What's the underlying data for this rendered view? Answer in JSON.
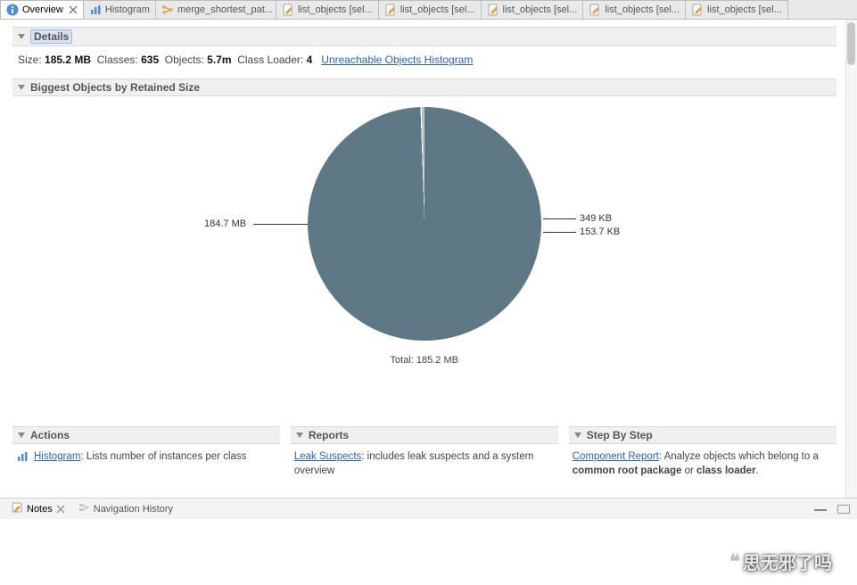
{
  "tabs": [
    {
      "label": "Overview",
      "icon": "info-icon",
      "active": true,
      "closable": true
    },
    {
      "label": "Histogram",
      "icon": "histogram-icon",
      "active": false,
      "closable": false
    },
    {
      "label": "merge_shortest_pat...",
      "icon": "merge-icon",
      "active": false,
      "closable": false
    },
    {
      "label": "list_objects [sel...",
      "icon": "doc-pencil-icon",
      "active": false,
      "closable": false
    },
    {
      "label": "list_objects [sel...",
      "icon": "doc-pencil-icon",
      "active": false,
      "closable": false
    },
    {
      "label": "list_objects [sel...",
      "icon": "doc-pencil-icon",
      "active": false,
      "closable": false
    },
    {
      "label": "list_objects [sel...",
      "icon": "doc-pencil-icon",
      "active": false,
      "closable": false
    },
    {
      "label": "list_objects [sel...",
      "icon": "doc-pencil-icon",
      "active": false,
      "closable": false
    }
  ],
  "sections": {
    "details_title": "Details",
    "biggest": "Biggest Objects by Retained Size",
    "actions": "Actions",
    "reports": "Reports",
    "step": "Step By Step"
  },
  "details": {
    "size_label": "Size:",
    "size_value": "185.2 MB",
    "classes_label": "Classes:",
    "classes_value": "635",
    "objects_label": "Objects:",
    "objects_value": "5.7m",
    "classloader_label": "Class Loader:",
    "classloader_value": "4",
    "unreachable_link": "Unreachable Objects Histogram"
  },
  "chart_data": {
    "type": "pie",
    "title": "",
    "total_label": "Total: 185.2 MB",
    "slices": [
      {
        "label": "184.7 MB",
        "value": 184.7,
        "unit": "MB",
        "color": "#5e7886"
      },
      {
        "label": "349 KB",
        "value": 0.341,
        "unit": "MB",
        "color": "#a8b9c2"
      },
      {
        "label": "153.7 KB",
        "value": 0.15,
        "unit": "MB",
        "color": "#c0ccd2"
      }
    ]
  },
  "actions": {
    "histogram_link": "Histogram",
    "histogram_desc": ": Lists number of instances per class"
  },
  "reports": {
    "leak_link": "Leak Suspects",
    "leak_desc": ": includes leak suspects and a system overview"
  },
  "step": {
    "component_link": "Component Report",
    "component_desc_1": ": Analyze objects which belong to a ",
    "component_strong_1": "common root package",
    "component_or": " or ",
    "component_strong_2": "class loader",
    "component_dot": "."
  },
  "bottom": {
    "notes": "Notes",
    "nav": "Navigation History"
  },
  "watermark": "思无邪了吗"
}
